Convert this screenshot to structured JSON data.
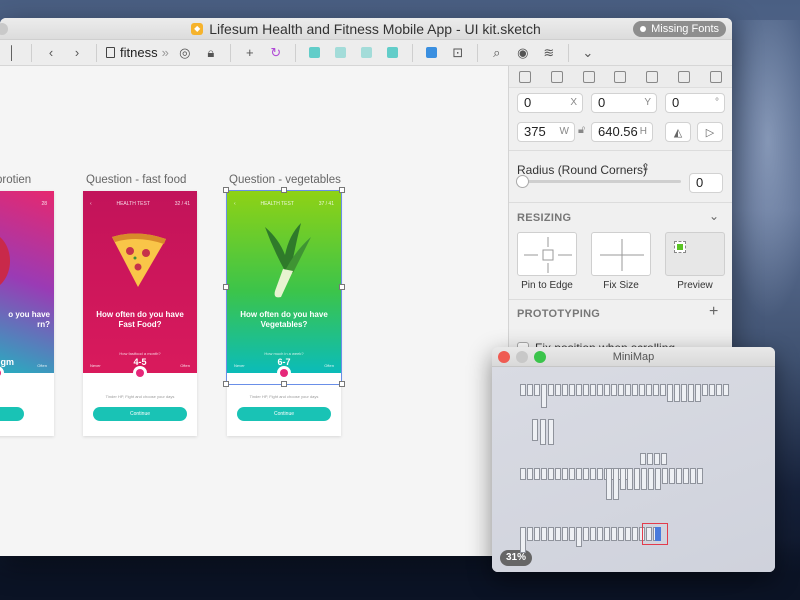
{
  "window": {
    "title": "Lifesum Health and Fitness Mobile App - UI kit.sketch",
    "missing_fonts": "Missing Fonts"
  },
  "toolbar": {
    "page_name": "fitness",
    "icons": [
      "back-icon",
      "forward-icon",
      "page-icon",
      "hide-icon",
      "lock-icon",
      "insert-icon",
      "symbol-icon",
      "union-icon",
      "subtract-icon",
      "intersect-icon",
      "difference-icon",
      "grid-icon",
      "scale-icon",
      "zoom-icon",
      "view-icon",
      "layers-icon",
      "more-icon"
    ]
  },
  "canvas": {
    "artboards": [
      {
        "title": "protien",
        "color_top": "#e6286f",
        "color_bottom": "#0fc6c2",
        "header_count": "28",
        "question": "How often do you have ... ern?",
        "question_l1": "o you have",
        "question_l2": "rn?",
        "range": "gm",
        "slider_label": "...",
        "never": "",
        "often": "Often",
        "note": "...ve your days",
        "button": "...tinue"
      },
      {
        "title": "Question - fast food",
        "color_top": "#c6155a",
        "color_bottom": "#e0205a",
        "header_label": "HEALTH TEST",
        "header_count": "32 / 41",
        "question_l1": "How often do you have",
        "question_l2": "Fast Food?",
        "slider_label": "How fastfood a month?",
        "range": "4-5",
        "never": "Never",
        "often": "Often",
        "note": "Tinder HP, Fight and choose your days",
        "button": "Continue"
      },
      {
        "title": "Question - vegetables",
        "color_top": "#8fd215",
        "color_bottom": "#0bbcb9",
        "header_label": "HEALTH TEST",
        "header_count": "37 / 41",
        "question_l1": "How often do you have",
        "question_l2": "Vegetables?",
        "slider_label": "How much in a week?",
        "range": "6-7",
        "never": "Never",
        "often": "Often",
        "note": "Tinder HP, Fight and choose your days",
        "button": "Continue"
      }
    ]
  },
  "inspector": {
    "x": "0",
    "x_label": "X",
    "y": "0",
    "y_label": "Y",
    "rotation": "0",
    "rotation_label": "°",
    "width": "375",
    "width_label": "W",
    "height": "640.56",
    "height_label": "H",
    "radius_label": "Radius (Round Corners)",
    "radius_value": "0",
    "resizing_label": "RESIZING",
    "pin_to_edge": "Pin to Edge",
    "fix_size": "Fix Size",
    "preview": "Preview",
    "prototyping_label": "PROTOTYPING",
    "fix_position": "Fix position when scrolling"
  },
  "minimap": {
    "title": "MiniMap",
    "zoom": "31%"
  },
  "colors": {
    "accent_teal": "#19c3b5",
    "selection_blue": "#4a7bdc",
    "minimap_highlight": "#e23c4c"
  }
}
